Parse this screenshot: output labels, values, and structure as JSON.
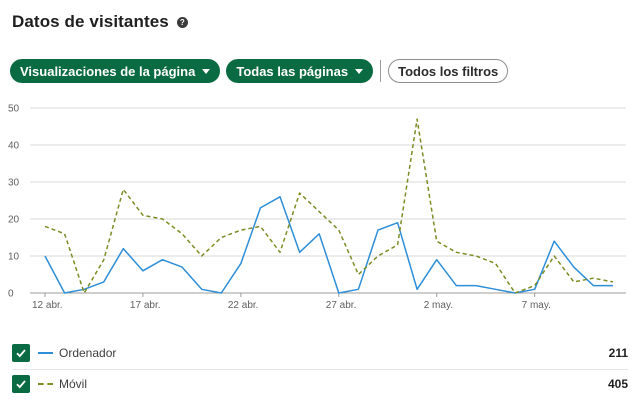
{
  "header": {
    "title": "Datos de visitantes",
    "help_icon": "question-circle-icon"
  },
  "filters": {
    "metric_label": "Visualizaciones de la página",
    "pages_label": "Todas las páginas",
    "all_filters_label": "Todos los filtros"
  },
  "colors": {
    "brand_green": "#0a6a41",
    "desktop_line": "#2e8ed8",
    "mobile_line": "#7a8c23"
  },
  "chart_data": {
    "type": "line",
    "title": "",
    "xlabel": "",
    "ylabel": "",
    "ylim": [
      0,
      50
    ],
    "yticks": [
      0,
      10,
      20,
      30,
      40,
      50
    ],
    "grid": true,
    "x": [
      "12 abr.",
      "13 abr.",
      "14 abr.",
      "15 abr.",
      "16 abr.",
      "17 abr.",
      "18 abr.",
      "19 abr.",
      "20 abr.",
      "21 abr.",
      "22 abr.",
      "23 abr.",
      "24 abr.",
      "25 abr.",
      "26 abr.",
      "27 abr.",
      "28 abr.",
      "29 abr.",
      "30 abr.",
      "1 may.",
      "2 may.",
      "3 may.",
      "4 may.",
      "5 may.",
      "6 may.",
      "7 may.",
      "8 may.",
      "9 may.",
      "10 may.",
      "11 may."
    ],
    "xticks": [
      {
        "index": 0,
        "label": "12 abr."
      },
      {
        "index": 5,
        "label": "17 abr."
      },
      {
        "index": 10,
        "label": "22 abr."
      },
      {
        "index": 15,
        "label": "27 abr."
      },
      {
        "index": 20,
        "label": "2 may."
      },
      {
        "index": 25,
        "label": "7 may."
      }
    ],
    "series": [
      {
        "name": "Ordenador",
        "style": "solid",
        "values": [
          10,
          0,
          1,
          3,
          12,
          6,
          9,
          7,
          1,
          0,
          8,
          23,
          26,
          11,
          16,
          0,
          1,
          17,
          19,
          1,
          9,
          2,
          2,
          1,
          0,
          1,
          14,
          7,
          2,
          2
        ]
      },
      {
        "name": "Móvil",
        "style": "dashed",
        "values": [
          18,
          16,
          0,
          9,
          28,
          21,
          20,
          16,
          10,
          15,
          17,
          18,
          11,
          27,
          22,
          17,
          5,
          10,
          13,
          47,
          14,
          11,
          10,
          8,
          0,
          2,
          10,
          3,
          4,
          3
        ]
      }
    ]
  },
  "legend": [
    {
      "label": "Ordenador",
      "total": "211"
    },
    {
      "label": "Móvil",
      "total": "405"
    }
  ]
}
